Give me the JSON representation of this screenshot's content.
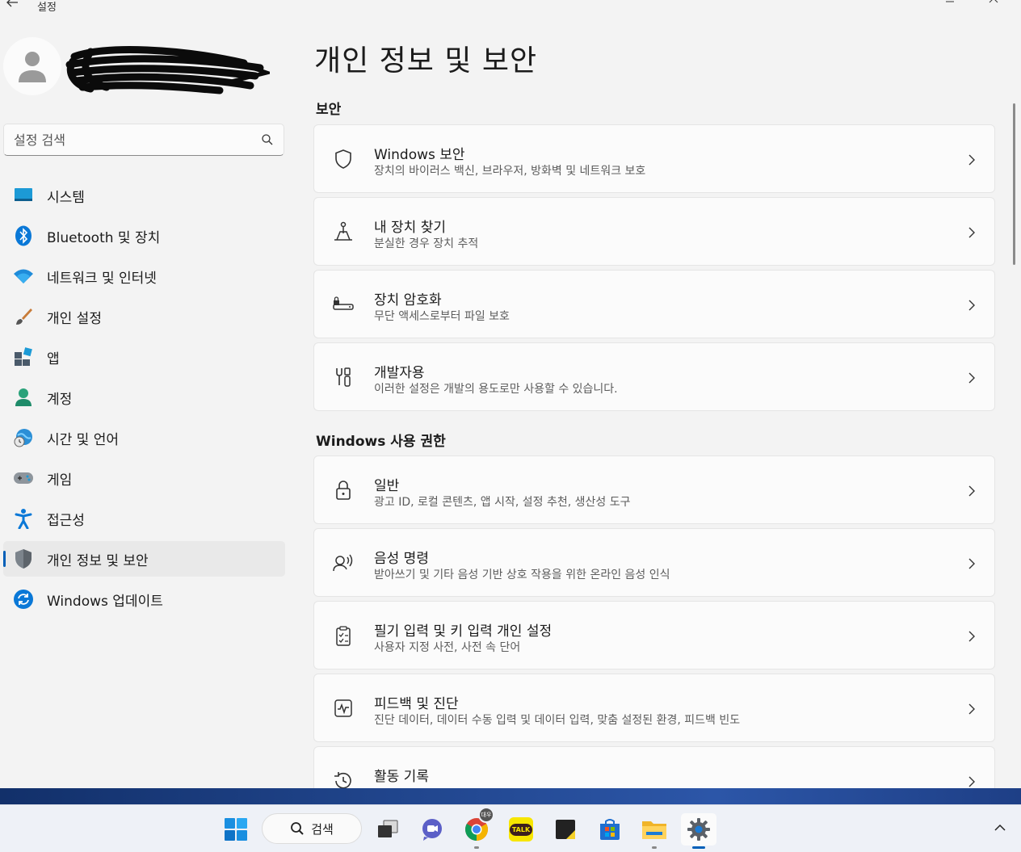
{
  "window": {
    "title": "설정"
  },
  "search": {
    "placeholder": "설정 검색"
  },
  "nav": [
    {
      "label": "시스템",
      "icon": "monitor-icon"
    },
    {
      "label": "Bluetooth 및 장치",
      "icon": "bluetooth-icon"
    },
    {
      "label": "네트워크 및 인터넷",
      "icon": "wifi-icon"
    },
    {
      "label": "개인 설정",
      "icon": "brush-icon"
    },
    {
      "label": "앱",
      "icon": "apps-icon"
    },
    {
      "label": "계정",
      "icon": "person-icon"
    },
    {
      "label": "시간 및 언어",
      "icon": "globe-clock-icon"
    },
    {
      "label": "게임",
      "icon": "gamepad-icon"
    },
    {
      "label": "접근성",
      "icon": "accessibility-icon"
    },
    {
      "label": "개인 정보 및 보안",
      "icon": "shield-icon",
      "active": true
    },
    {
      "label": "Windows 업데이트",
      "icon": "update-icon"
    }
  ],
  "page": {
    "title": "개인 정보 및 보안"
  },
  "sections": [
    {
      "label": "보안",
      "cards": [
        {
          "title": "Windows 보안",
          "subtitle": "장치의 바이러스 백신, 브라우저, 방화벽 및 네트워크 보호",
          "icon": "shield-outline-icon"
        },
        {
          "title": "내 장치 찾기",
          "subtitle": "분실한 경우 장치 추적",
          "icon": "find-device-icon"
        },
        {
          "title": "장치 암호화",
          "subtitle": "무단 액세스로부터 파일 보호",
          "icon": "drive-lock-icon"
        },
        {
          "title": "개발자용",
          "subtitle": "이러한 설정은 개발의 용도로만 사용할 수 있습니다.",
          "icon": "developer-tools-icon"
        }
      ]
    },
    {
      "label": "Windows 사용 권한",
      "cards": [
        {
          "title": "일반",
          "subtitle": "광고 ID, 로컬 콘텐츠, 앱 시작, 설정 추천, 생산성 도구",
          "icon": "lock-icon"
        },
        {
          "title": "음성 명령",
          "subtitle": "받아쓰기 및 기타 음성 기반 상호 작용을 위한 온라인 음성 인식",
          "icon": "speech-icon"
        },
        {
          "title": "필기 입력 및 키 입력 개인 설정",
          "subtitle": "사용자 지정 사전, 사전 속 단어",
          "icon": "clipboard-check-icon"
        },
        {
          "title": "피드백 및 진단",
          "subtitle": "진단 데이터, 데이터 수동 입력 및 데이터 입력, 맞춤 설정된 환경, 피드백 빈도",
          "icon": "pulse-icon"
        },
        {
          "title": "활동 기록",
          "subtitle": "",
          "icon": "history-icon"
        }
      ]
    }
  ],
  "taskbar": {
    "search_label": "검색",
    "items": [
      "start-icon",
      "task-view-icon",
      "chat-icon",
      "chrome-icon",
      "kakaotalk-icon",
      "sticky-notes-icon",
      "store-icon",
      "file-explorer-icon",
      "settings-icon"
    ],
    "kakaotalk_label": "TALK",
    "chrome_badge": "대우"
  },
  "colors": {
    "accent": "#005fb8"
  }
}
